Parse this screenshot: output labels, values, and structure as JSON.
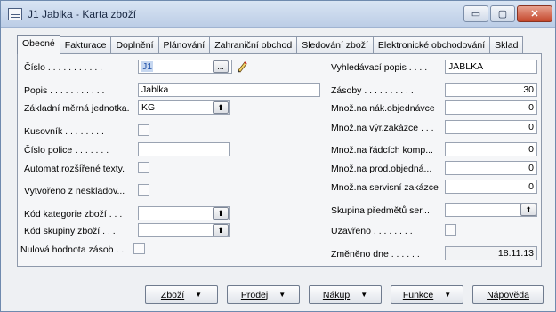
{
  "window": {
    "title": "J1 Jablka - Karta zboží",
    "icon": "document-icon"
  },
  "title_buttons": {
    "minimize": "▭",
    "maximize": "▢",
    "close": "✕"
  },
  "tabs": [
    "Obecné",
    "Fakturace",
    "Doplnění",
    "Plánování",
    "Zahraniční obchod",
    "Sledování zboží",
    "Elektronické obchodování",
    "Sklad"
  ],
  "left_fields": {
    "cislo": {
      "label": "Číslo . . . . . . . . . . .",
      "value": "J1"
    },
    "popis": {
      "label": "Popis . . . . . . . . . . .",
      "value": "Jablka"
    },
    "jednotka": {
      "label": "Základní měrná jednotka.",
      "value": "KG"
    },
    "kusovnik": {
      "label": "Kusovník . . . . . . . ."
    },
    "police": {
      "label": "Číslo police . . . . . . .",
      "value": ""
    },
    "automat": {
      "label": "Automat.rozšířené texty."
    },
    "vytvoreno": {
      "label": "Vytvořeno z neskladov..."
    },
    "kategorie": {
      "label": "Kód kategorie zboží . . .",
      "value": ""
    },
    "skupina": {
      "label": "Kód skupiny zboží . . .",
      "value": ""
    },
    "nulova": {
      "label": "Nulová hodnota zásob . ."
    }
  },
  "right_fields": {
    "vyhledavaci": {
      "label": "Vyhledávací popis . . . .",
      "value": "JABLKA"
    },
    "zasoby": {
      "label": "Zásoby . . . . . . . . . .",
      "value": "30"
    },
    "nak_objednavce": {
      "label": "Množ.na nák.objednávce",
      "value": "0"
    },
    "vyr_zakazce": {
      "label": "Množ.na výr.zakázce . . .",
      "value": "0"
    },
    "radcich_komp": {
      "label": "Množ.na řádcích komp...",
      "value": "0"
    },
    "prod_objedna": {
      "label": "Množ.na prod.objedná...",
      "value": "0"
    },
    "servisni": {
      "label": "Množ.na servisní zakázce",
      "value": "0"
    },
    "skupina_predmetu": {
      "label": "Skupina předmětů ser...",
      "value": ""
    },
    "uzavreno": {
      "label": "Uzavřeno . . . . . . . ."
    },
    "zmeneno": {
      "label": "Změněno dne . . . . . .",
      "value": "18.11.13"
    }
  },
  "bottom_buttons": {
    "zbozi": "Zboží",
    "prodej": "Prodej",
    "nakup": "Nákup",
    "funkce": "Funkce",
    "napoveda": "Nápověda"
  }
}
